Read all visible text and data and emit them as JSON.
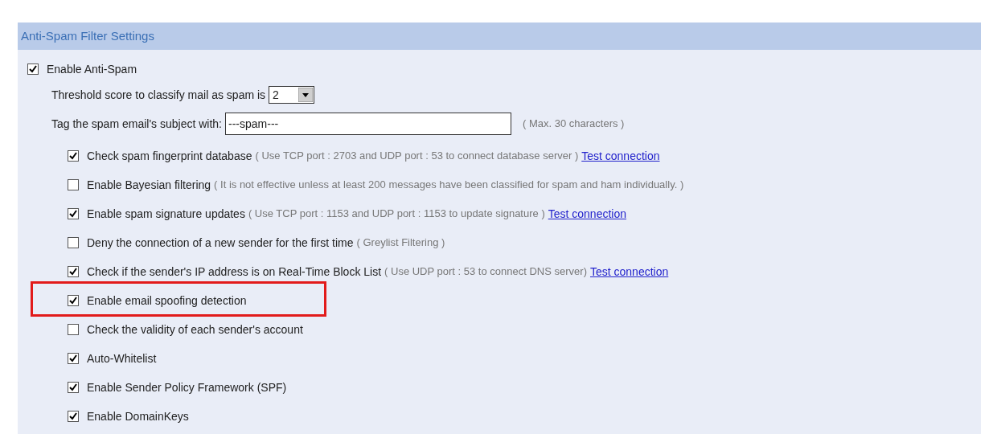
{
  "section": {
    "title": "Anti-Spam Filter Settings"
  },
  "enable": {
    "label": "Enable Anti-Spam",
    "checked": true
  },
  "threshold": {
    "label": "Threshold score to classify mail as spam is",
    "value": "2"
  },
  "tag": {
    "label": "Tag the spam email's subject with:",
    "value": "---spam---",
    "note": "( Max. 30 characters )"
  },
  "options": [
    {
      "label": "Check spam fingerprint database",
      "note": "( Use TCP port : 2703 and UDP port : 53 to connect database server )",
      "link": "Test connection",
      "checked": true,
      "highlighted": false
    },
    {
      "label": "Enable Bayesian filtering",
      "note": "( It is not effective unless at least 200 messages have been classified for spam and ham individually. )",
      "checked": false,
      "highlighted": false
    },
    {
      "label": "Enable spam signature updates",
      "note": "( Use TCP port : 1153 and UDP port : 1153 to update signature )",
      "link": "Test connection",
      "checked": true,
      "highlighted": false
    },
    {
      "label": "Deny the connection of a new sender for the first time",
      "note": "( Greylist Filtering )",
      "checked": false,
      "highlighted": false
    },
    {
      "label": "Check if the sender's IP address is on Real-Time Block List",
      "note": "( Use UDP port : 53 to connect DNS server)",
      "link": "Test connection",
      "checked": true,
      "highlighted": false
    },
    {
      "label": "Enable email spoofing detection",
      "checked": true,
      "highlighted": true
    },
    {
      "label": "Check the validity of each sender's account",
      "checked": false,
      "highlighted": false
    },
    {
      "label": "Auto-Whitelist",
      "checked": true,
      "highlighted": false
    },
    {
      "label": "Enable Sender Policy Framework (SPF)",
      "checked": true,
      "highlighted": false
    },
    {
      "label": "Enable DomainKeys",
      "checked": true,
      "highlighted": false
    }
  ]
}
